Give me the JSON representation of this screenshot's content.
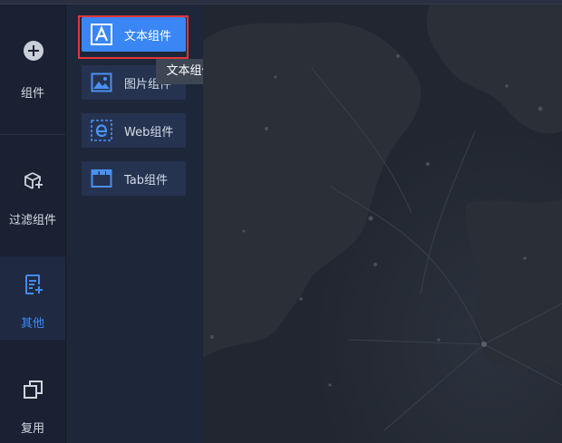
{
  "rail": {
    "items": [
      {
        "label": "组件",
        "icon": "plus-circle-icon"
      },
      {
        "label": "过滤组件",
        "icon": "box-plus-icon"
      },
      {
        "label": "其他",
        "icon": "doc-plus-icon",
        "active": true
      },
      {
        "label": "复用",
        "icon": "copy-icon"
      }
    ]
  },
  "panel": {
    "components": [
      {
        "label": "文本组件",
        "icon": "text-a-icon",
        "active": true
      },
      {
        "label": "图片组件",
        "icon": "image-icon"
      },
      {
        "label": "Web组件",
        "icon": "web-e-icon"
      },
      {
        "label": "Tab组件",
        "icon": "tab-icon"
      }
    ]
  },
  "tooltip": {
    "text": "文本组件"
  },
  "colors": {
    "accent": "#3a86f5",
    "highlight": "#e0353a",
    "rail_bg": "#1a2132",
    "panel_bg": "#1e2739"
  }
}
